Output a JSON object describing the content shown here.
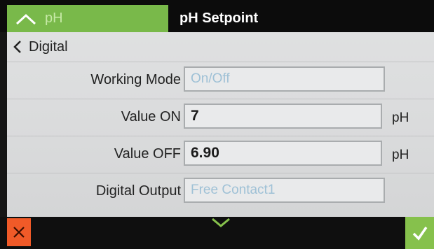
{
  "header": {
    "back_tab_label": "pH",
    "title": "pH Setpoint",
    "back_icon": "chevron-up-icon"
  },
  "breadcrumb": {
    "label": "Digital",
    "icon": "chevron-left-icon"
  },
  "fields": [
    {
      "label": "Working Mode",
      "value": "On/Off",
      "unit": "",
      "editable": false
    },
    {
      "label": "Value ON",
      "value": "7",
      "unit": "pH",
      "editable": true
    },
    {
      "label": "Value OFF",
      "value": "6.90",
      "unit": "pH",
      "editable": true
    },
    {
      "label": "Digital Output",
      "value": "Free Contact1",
      "unit": "",
      "editable": false
    }
  ],
  "footer": {
    "cancel_icon": "close-icon",
    "scroll_icon": "chevron-down-icon",
    "confirm_icon": "checkmark-icon"
  },
  "colors": {
    "accent_green": "#79b94a",
    "cancel_orange": "#f05a28",
    "confirm_green": "#86c14c",
    "readonly_text": "#9fc1d6"
  }
}
